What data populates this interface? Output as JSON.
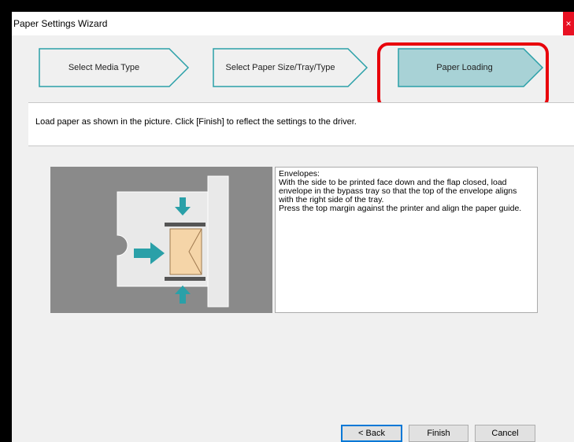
{
  "window": {
    "title": "Paper Settings Wizard",
    "close_label": "×"
  },
  "steps": [
    {
      "label": "Select Media Type",
      "active": false
    },
    {
      "label": "Select Paper Size/Tray/Type",
      "active": false
    },
    {
      "label": "Paper Loading",
      "active": true
    }
  ],
  "instruction": "Load paper as shown in the picture. Click [Finish] to reflect the settings to the driver.",
  "description": {
    "lines": [
      "Envelopes:",
      "With the side to be printed face down and the flap closed, load",
      "envelope in the bypass tray so that the top of the envelope aligns",
      "with the right side of the tray.",
      "Press the top margin against the printer and align the paper guide."
    ]
  },
  "buttons": {
    "back": "< Back",
    "finish": "Finish",
    "cancel": "Cancel"
  },
  "colors": {
    "accent_teal": "#2aa0a8",
    "active_step_fill": "#a8d2d6",
    "highlight_red": "#e8000b",
    "envelope": "#f5d5a8"
  }
}
